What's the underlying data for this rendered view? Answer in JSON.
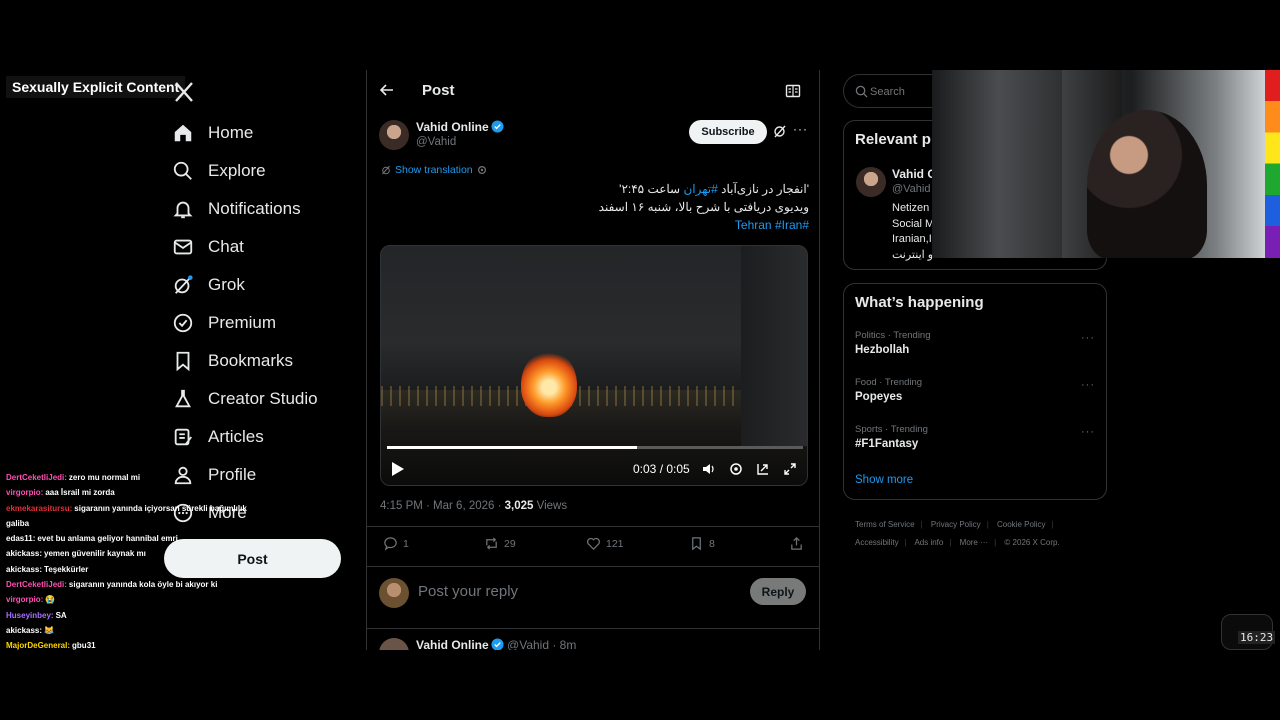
{
  "overlay": {
    "label": "Sexually Explicit Content"
  },
  "nav": {
    "items": [
      {
        "label": "Home"
      },
      {
        "label": "Explore"
      },
      {
        "label": "Notifications"
      },
      {
        "label": "Chat"
      },
      {
        "label": "Grok"
      },
      {
        "label": "Premium"
      },
      {
        "label": "Bookmarks"
      },
      {
        "label": "Creator Studio"
      },
      {
        "label": "Articles"
      },
      {
        "label": "Profile"
      },
      {
        "label": "More"
      }
    ],
    "post_label": "Post"
  },
  "chat": [
    {
      "user": "DertCeketliJedi:",
      "msg": "zero mu normal mi",
      "color": "#ff4fb2"
    },
    {
      "user": "virgorpio:",
      "msg": "aaa İsrail mi zorda",
      "color": "#ff4fb2"
    },
    {
      "user": "ekmekarasitursu:",
      "msg": "sigaranın yanında içiyorsan sürekli bağımlılık galiba",
      "color": "#e0303a"
    },
    {
      "user": "edas11:",
      "msg": "evet bu anlama geliyor hannibal emri",
      "color": "#ffffff"
    },
    {
      "user": "akickass:",
      "msg": "yemen güvenilir kaynak mı",
      "color": "#ffffff"
    },
    {
      "user": "akickass:",
      "msg": "Teşekkürler",
      "color": "#ffffff"
    },
    {
      "user": "DertCeketliJedi:",
      "msg": "sigaranın yanında kola öyle bi akıyor ki",
      "color": "#ff4fb2"
    },
    {
      "user": "virgorpio:",
      "msg": "😭",
      "color": "#ff4fb2"
    },
    {
      "user": "Huseyinbey:",
      "msg": "SA",
      "color": "#a970ff"
    },
    {
      "user": "akickass:",
      "msg": "😹",
      "color": "#ffffff"
    },
    {
      "user": "MajorDeGeneral:",
      "msg": "gbu31",
      "color": "#ffd700"
    }
  ],
  "header": {
    "title": "Post"
  },
  "tweet": {
    "name": "Vahid Online",
    "handle": "@Vahid",
    "subscribe_label": "Subscribe",
    "more": "···",
    "translate_label": "Show translation",
    "line1_prefix": "'انفجار در نازی‌آباد ",
    "line1_tag": "#تهران",
    "line1_suffix": " ساعت ۲:۴۵'",
    "line2": "ویدیوی دریافتی با شرح بالا، شنبه ۱۶ اسفند",
    "tag1": "#Tehran",
    "tag2": "#Iran",
    "video_time": "0:03 / 0:05",
    "video_progress": 0.6,
    "meta_time": "4:15 PM · Mar 6, 2026 · ",
    "views_count": "3,025",
    "views_label": " Views",
    "replies": "1",
    "reposts": "29",
    "likes": "121",
    "bookmarks": "8"
  },
  "reply": {
    "placeholder": "Post your reply",
    "button": "Reply"
  },
  "next_tweet": {
    "name": "Vahid Online",
    "sub": "@Vahid · 8m"
  },
  "search": {
    "placeholder": "Search"
  },
  "relevant": {
    "title": "Relevant p",
    "name": "Vahid O",
    "handle": "@Vahid",
    "bio1": "Netizen",
    "bio2": "Social M",
    "bio3": "Iranian,I",
    "bio4": "و اینترنت"
  },
  "happening": {
    "title": "What’s happening",
    "trends": [
      {
        "ctx": "Politics · Trending",
        "name": "Hezbollah"
      },
      {
        "ctx": "Food · Trending",
        "name": "Popeyes"
      },
      {
        "ctx": "Sports · Trending",
        "name": "#F1Fantasy"
      }
    ],
    "show_more": "Show more"
  },
  "footer": {
    "links": [
      "Terms of Service",
      "Privacy Policy",
      "Cookie Policy",
      "Accessibility",
      "Ads info",
      "More ···"
    ],
    "copyright": "© 2026 X Corp."
  },
  "clock": "16:23"
}
